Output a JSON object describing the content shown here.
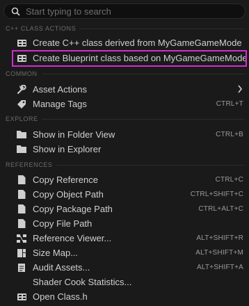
{
  "search": {
    "placeholder": "Start typing to search"
  },
  "sections": {
    "cpp": "C++ CLASS ACTIONS",
    "common": "COMMON",
    "explore": "EXPLORE",
    "references": "REFERENCES"
  },
  "cpp_items": [
    {
      "label": "Create C++ class derived from MyGameGameMode",
      "icon": "class-icon"
    },
    {
      "label": "Create Blueprint class based on MyGameGameMode",
      "icon": "class-icon"
    }
  ],
  "common_items": [
    {
      "label": "Asset Actions",
      "icon": "wrench-icon",
      "shortcut": ""
    },
    {
      "label": "Manage Tags",
      "icon": "tag-icon",
      "shortcut": "CTRL+T"
    }
  ],
  "explore_items": [
    {
      "label": "Show in Folder View",
      "icon": "folder-icon",
      "shortcut": "CTRL+B"
    },
    {
      "label": "Show in Explorer",
      "icon": "folder-icon",
      "shortcut": ""
    }
  ],
  "reference_items": [
    {
      "label": "Copy Reference",
      "icon": "copy-icon",
      "shortcut": "CTRL+C"
    },
    {
      "label": "Copy Object Path",
      "icon": "copy-icon",
      "shortcut": "CTRL+SHIFT+C"
    },
    {
      "label": "Copy Package Path",
      "icon": "copy-icon",
      "shortcut": "CTRL+ALT+C"
    },
    {
      "label": "Copy File Path",
      "icon": "copy-icon",
      "shortcut": ""
    },
    {
      "label": "Reference Viewer...",
      "icon": "reference-viewer-icon",
      "shortcut": "ALT+SHIFT+R"
    },
    {
      "label": "Size Map...",
      "icon": "size-map-icon",
      "shortcut": "ALT+SHIFT+M"
    },
    {
      "label": "Audit Assets...",
      "icon": "audit-icon",
      "shortcut": "ALT+SHIFT+A"
    },
    {
      "label": "Shader Cook Statistics...",
      "icon": "",
      "shortcut": ""
    },
    {
      "label": "Open Class.h",
      "icon": "class-icon",
      "shortcut": ""
    }
  ],
  "colors": {
    "highlight": "#d12dd1",
    "background": "#1a1a1a"
  }
}
